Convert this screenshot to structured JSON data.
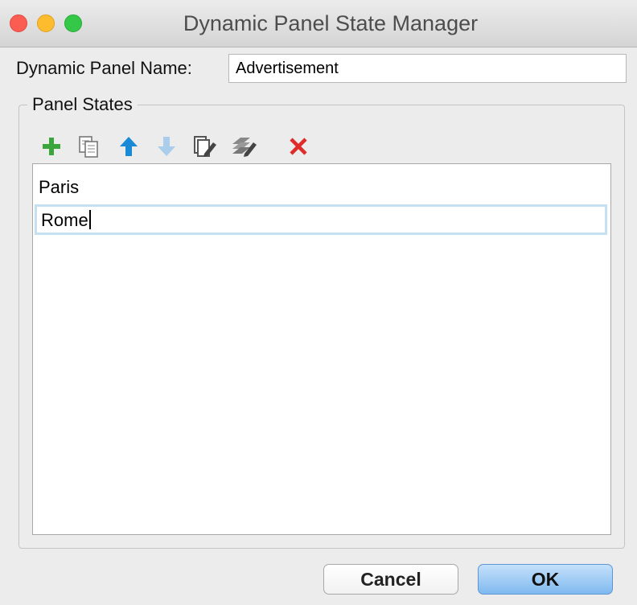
{
  "window": {
    "title": "Dynamic Panel State Manager",
    "controls": [
      "close",
      "minimize",
      "maximize"
    ]
  },
  "panel_name": {
    "label": "Dynamic Panel Name:",
    "value": "Advertisement"
  },
  "states_group": {
    "legend": "Panel States",
    "toolbar": [
      {
        "icon": "add-icon",
        "enabled": true,
        "color": "#3aa53a"
      },
      {
        "icon": "duplicate-icon",
        "enabled": true
      },
      {
        "icon": "move-up-icon",
        "enabled": true,
        "color": "#1a8ad4"
      },
      {
        "icon": "move-down-icon",
        "enabled": false,
        "color": "#a9cdeb"
      },
      {
        "icon": "edit-state-icon",
        "enabled": true
      },
      {
        "icon": "edit-all-states-icon",
        "enabled": true
      },
      {
        "icon": "delete-icon",
        "enabled": true,
        "color": "#e02b2b"
      }
    ],
    "states": [
      {
        "label": "Paris",
        "editing": false
      },
      {
        "label": "Rome",
        "editing": true
      }
    ]
  },
  "buttons": {
    "cancel": "Cancel",
    "ok": "OK"
  }
}
